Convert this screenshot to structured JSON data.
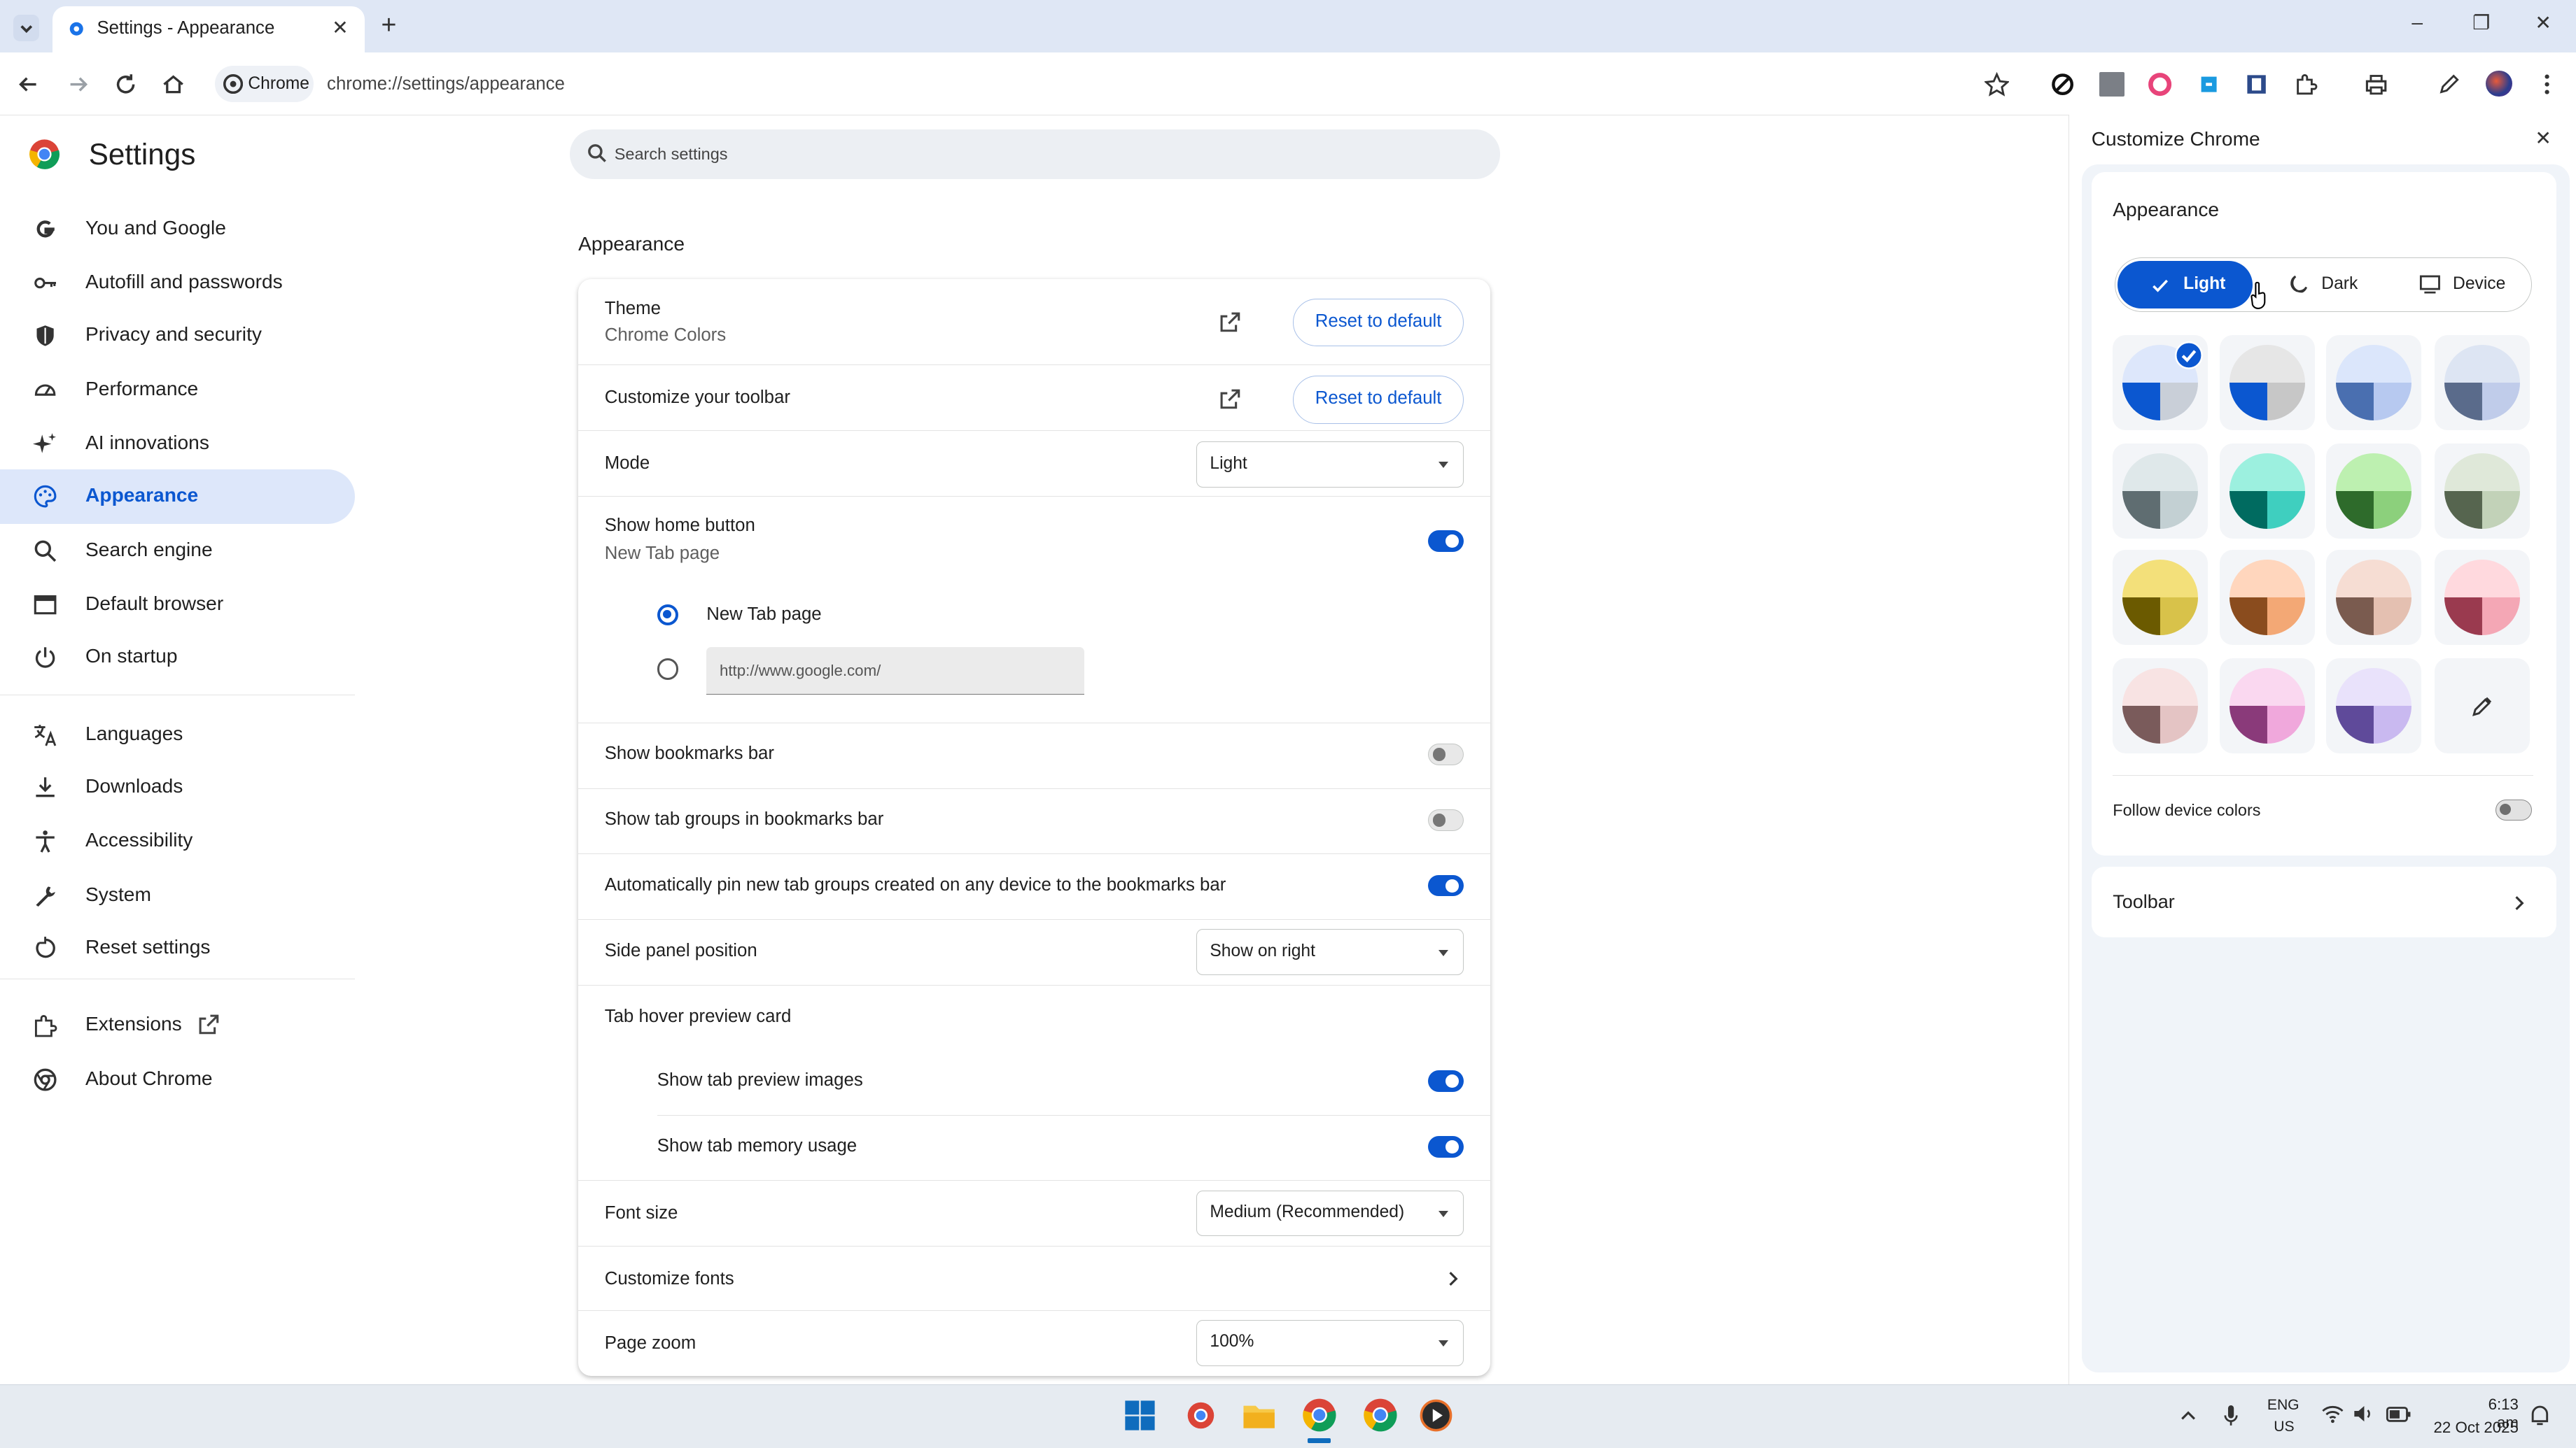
{
  "window": {
    "tab_title": "Settings - Appearance",
    "new_tab": "+",
    "minimize": "–",
    "restore": "❐",
    "close": "✕"
  },
  "toolbar": {
    "chip_label": "Chrome",
    "url": "chrome://settings/appearance"
  },
  "settings": {
    "title": "Settings",
    "search_placeholder": "Search settings",
    "nav": [
      {
        "label": "You and Google",
        "icon": "google-g-icon"
      },
      {
        "label": "Autofill and passwords",
        "icon": "key-icon"
      },
      {
        "label": "Privacy and security",
        "icon": "shield-icon"
      },
      {
        "label": "Performance",
        "icon": "speedometer-icon"
      },
      {
        "label": "AI innovations",
        "icon": "sparkle-icon"
      },
      {
        "label": "Appearance",
        "icon": "palette-icon"
      },
      {
        "label": "Search engine",
        "icon": "search-icon"
      },
      {
        "label": "Default browser",
        "icon": "browser-window-icon"
      },
      {
        "label": "On startup",
        "icon": "power-icon"
      },
      {
        "label": "Languages",
        "icon": "translate-icon"
      },
      {
        "label": "Downloads",
        "icon": "download-icon"
      },
      {
        "label": "Accessibility",
        "icon": "accessibility-icon"
      },
      {
        "label": "System",
        "icon": "wrench-icon"
      },
      {
        "label": "Reset settings",
        "icon": "reset-icon"
      },
      {
        "label": "Extensions",
        "icon": "puzzle-icon"
      },
      {
        "label": "About Chrome",
        "icon": "chrome-logo-icon"
      }
    ]
  },
  "appearance": {
    "heading": "Appearance",
    "theme_label": "Theme",
    "theme_value": "Chrome Colors",
    "reset_label": "Reset to default",
    "customize_toolbar": "Customize your toolbar",
    "mode_label": "Mode",
    "mode_value": "Light",
    "home_button_label": "Show home button",
    "home_button_sub": "New Tab page",
    "home_button_on": true,
    "radio_newtab": "New Tab page",
    "radio_url_value": "http://www.google.com/",
    "bookmarks_bar": "Show bookmarks bar",
    "bookmarks_bar_on": false,
    "tab_groups_bar": "Show tab groups in bookmarks bar",
    "tab_groups_bar_on": false,
    "auto_pin": "Automatically pin new tab groups created on any device to the bookmarks bar",
    "auto_pin_on": true,
    "side_panel_label": "Side panel position",
    "side_panel_value": "Show on right",
    "hover_card_label": "Tab hover preview card",
    "preview_images": "Show tab preview images",
    "preview_images_on": true,
    "memory_usage": "Show tab memory usage",
    "memory_usage_on": true,
    "font_size_label": "Font size",
    "font_size_value": "Medium (Recommended)",
    "customize_fonts": "Customize fonts",
    "page_zoom_label": "Page zoom",
    "page_zoom_value": "100%"
  },
  "panel": {
    "title": "Customize Chrome",
    "appearance_heading": "Appearance",
    "mode_light": "Light",
    "mode_dark": "Dark",
    "mode_device": "Device",
    "follow_device": "Follow device colors",
    "follow_device_on": false,
    "toolbar_label": "Toolbar",
    "swatches": [
      {
        "top": "#dde7fb",
        "left": "#0b57d0",
        "right": "#c9cfd8",
        "selected": true
      },
      {
        "top": "#e6e6e6",
        "left": "#0b57d0",
        "right": "#c7c7c7",
        "selected": false
      },
      {
        "top": "#dbe6fb",
        "left": "#4a6fb0",
        "right": "#b7c9f0",
        "selected": false
      },
      {
        "top": "#dde5f3",
        "left": "#5a6b8b",
        "right": "#c0ccea",
        "selected": false
      },
      {
        "top": "#dfe8ea",
        "left": "#5f6d71",
        "right": "#c3d0d3",
        "selected": false
      },
      {
        "top": "#9cf0df",
        "left": "#006b60",
        "right": "#3fcfbf",
        "selected": false
      },
      {
        "top": "#bdf0b0",
        "left": "#2e6b2b",
        "right": "#8cd07c",
        "selected": false
      },
      {
        "top": "#dfe8d9",
        "left": "#56654f",
        "right": "#c2d2b8",
        "selected": false
      },
      {
        "top": "#f3e07a",
        "left": "#6b5a00",
        "right": "#d8c24a",
        "selected": false
      },
      {
        "top": "#ffd6bd",
        "left": "#8a4c1e",
        "right": "#f3a875",
        "selected": false
      },
      {
        "top": "#f6ddd3",
        "left": "#7a5b4f",
        "right": "#e4c0b1",
        "selected": false
      },
      {
        "top": "#ffd9de",
        "left": "#9a3a4f",
        "right": "#f4a7b5",
        "selected": false
      },
      {
        "top": "#f8e3e3",
        "left": "#7a5b5b",
        "right": "#e4c4c4",
        "selected": false
      },
      {
        "top": "#fad8f0",
        "left": "#8a3a7a",
        "right": "#f0a8dc",
        "selected": false
      },
      {
        "top": "#e9e2fb",
        "left": "#5f4a9a",
        "right": "#c9b9f0",
        "selected": false
      },
      {
        "custom": true
      }
    ]
  },
  "taskbar": {
    "lang_top": "ENG",
    "lang_bottom": "US",
    "time": "6:13 am",
    "date": "22 Oct 2025"
  },
  "colors": {
    "accent": "#0b57d0",
    "active_nav_bg": "#dde7fa",
    "titlebar_bg": "#dfe7f5",
    "taskbar_bg": "#e6ebf1"
  }
}
